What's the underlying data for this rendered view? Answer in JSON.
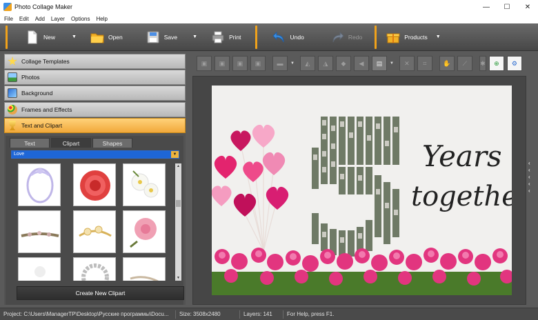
{
  "window": {
    "title": "Photo Collage Maker"
  },
  "menu": [
    "File",
    "Edit",
    "Add",
    "Layer",
    "Options",
    "Help"
  ],
  "toolbar": {
    "new": "New",
    "open": "Open",
    "save": "Save",
    "print": "Print",
    "undo": "Undo",
    "redo": "Redo",
    "products": "Products"
  },
  "accordion": {
    "templates": "Collage Templates",
    "photos": "Photos",
    "background": "Background",
    "frames": "Frames and Effects",
    "text": "Text and Clipart"
  },
  "clip_tabs": [
    "Text",
    "Clipart",
    "Shapes"
  ],
  "category": {
    "selected": "Love"
  },
  "create_button": "Create New Clipart",
  "collage": {
    "line1": "Years",
    "line2": "together"
  },
  "status": {
    "project": "Project: C:\\Users\\ManagerTP\\Desktop\\Русские программы\\Docu...",
    "size": "Size: 3508x2480",
    "layers": "Layers: 141",
    "help": "For Help, press F1."
  },
  "colors": {
    "accent": "#f0a21b",
    "selection": "#1e66d6",
    "pink": "#e8378a"
  }
}
